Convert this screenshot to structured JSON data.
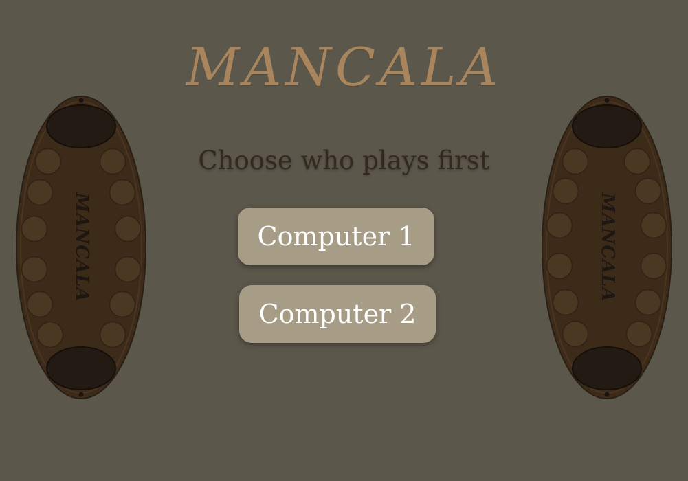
{
  "title": "MANCALA",
  "subtitle": "Choose who plays first",
  "buttons": {
    "computer1": "Computer 1",
    "computer2": "Computer 2"
  },
  "board": {
    "label": "MANCALA",
    "pits_per_side": 6
  },
  "colors": {
    "background": "#5c574b",
    "title": "#a9855e",
    "subtitle": "#33291f",
    "button": "#a79d87",
    "board": "#3d2b1a",
    "pit": "#4a3621",
    "store": "#221a14"
  }
}
